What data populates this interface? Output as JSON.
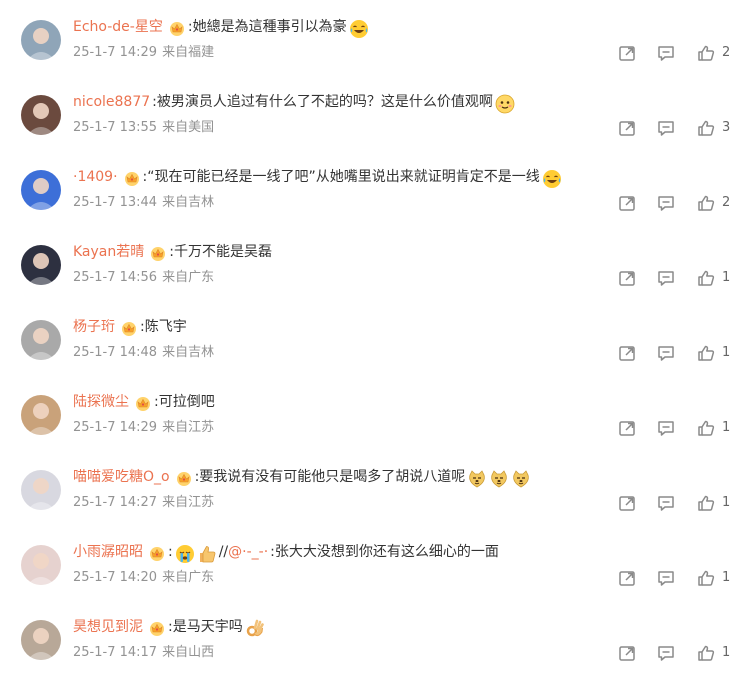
{
  "comments": [
    {
      "user": "Echo-de-星空",
      "badge": true,
      "text": ":她總是為這種事引以為豪",
      "emojis": [
        "laugh-cry"
      ],
      "date": "25-1-7",
      "time": "14:29",
      "location": "来自福建",
      "likes": "2",
      "avatar_color": "#8fa5b8"
    },
    {
      "user": "nicole8877",
      "badge": false,
      "text": ":被男演员人追过有什么了不起的吗？这是什么价值观啊",
      "emojis": [
        "shy-smile"
      ],
      "date": "25-1-7",
      "time": "13:55",
      "location": "来自美国",
      "likes": "3",
      "avatar_color": "#6b4a3e"
    },
    {
      "user": "·1409·",
      "badge": true,
      "text": ":“现在可能已经是一线了吧”从她嘴里说出来就证明肯定不是一线",
      "emojis": [
        "laugh-cry"
      ],
      "date": "25-1-7",
      "time": "13:44",
      "location": "来自吉林",
      "likes": "2",
      "avatar_color": "#3d6fd8"
    },
    {
      "user": "Kayan若晴",
      "badge": true,
      "text": ":千万不能是吴磊",
      "emojis": [],
      "date": "25-1-7",
      "time": "14:56",
      "location": "来自广东",
      "likes": "1",
      "avatar_color": "#2d3040"
    },
    {
      "user": "杨子珩",
      "badge": true,
      "text": ":陈飞宇",
      "emojis": [],
      "date": "25-1-7",
      "time": "14:48",
      "location": "来自吉林",
      "likes": "1",
      "avatar_color": "#a9a9a9"
    },
    {
      "user": "陆探微尘",
      "badge": true,
      "text": ":可拉倒吧",
      "emojis": [],
      "date": "25-1-7",
      "time": "14:29",
      "location": "来自江苏",
      "likes": "1",
      "avatar_color": "#c9a27a"
    },
    {
      "user": "喵喵爱吃糖O_o",
      "badge": true,
      "text": ":要我说有没有可能他只是喝多了胡说八道呢",
      "emojis": [
        "doge",
        "doge",
        "doge"
      ],
      "date": "25-1-7",
      "time": "14:27",
      "location": "来自江苏",
      "likes": "1",
      "avatar_color": "#d8d8e0"
    },
    {
      "user": "小雨潺昭昭",
      "badge": true,
      "text": ":",
      "emojis": [
        "crying",
        "thumbs-up"
      ],
      "mention_prefix": "//",
      "mention": "@·-_-·",
      "tail": ":张大大没想到你还有这么细心的一面",
      "date": "25-1-7",
      "time": "14:20",
      "location": "来自广东",
      "likes": "1",
      "avatar_color": "#e6d2cf"
    },
    {
      "user": "昊想见到泥",
      "badge": true,
      "text": ":是马天宇吗",
      "emojis": [
        "ok-hand"
      ],
      "date": "25-1-7",
      "time": "14:17",
      "location": "来自山西",
      "likes": "1",
      "avatar_color": "#b8a898"
    }
  ],
  "icons": {
    "share": "share-icon",
    "comment": "comment-icon",
    "like": "like-icon",
    "badge": "vip-crown-icon"
  },
  "colors": {
    "username": "#eb7350",
    "meta": "#939393",
    "text": "#333333",
    "icon": "#8a8a8a"
  }
}
